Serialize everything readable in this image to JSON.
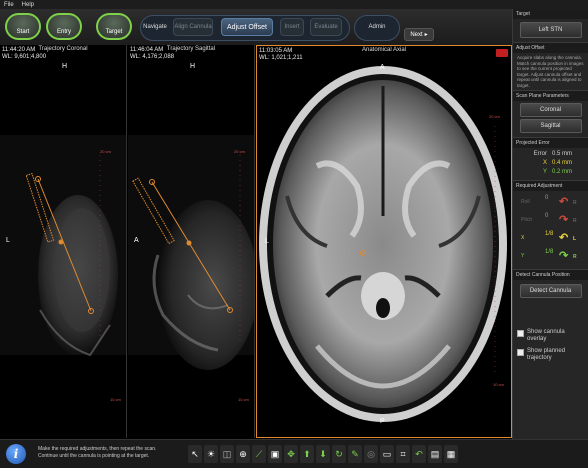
{
  "menu": {
    "file": "File",
    "help": "Help"
  },
  "workflow": {
    "start": "Start",
    "entry": "Entry",
    "target": "Target"
  },
  "nav_group": {
    "navigate": "Navigate",
    "align_cannula": "Align Cannula",
    "adjust_offset": "Adjust Offset",
    "insert": "Insert",
    "evaluate": "Evaluate"
  },
  "admin": "Admin",
  "next": {
    "label": "Next",
    "arrow": "▸"
  },
  "viewports": [
    {
      "title": "Trajectory Coronal",
      "time": "11:44:20 AM",
      "wl": "WL: 9,601;4,800",
      "marker": "H",
      "side": "L",
      "scale_top": "20 cm",
      "scale_bottom": "10 cm"
    },
    {
      "title": "Trajectory Sagittal",
      "time": "11:46:04 AM",
      "wl": "WL: 4,176;2,088",
      "marker": "H",
      "side": "A",
      "scale_top": "20 cm",
      "scale_bottom": "10 cm"
    },
    {
      "title": "Anatomical Axial",
      "time": "11:03:05 AM",
      "wl": "WL: 1,021;1,211",
      "marker": "A",
      "side": "L",
      "scale_top": "20 cm",
      "scale_bottom": "10 cm",
      "bottom_marker": "P"
    }
  ],
  "panel": {
    "target_header": "Target",
    "target_value": "Left STN",
    "adjust_offset_header": "Adjust Offset",
    "adjust_offset_desc": "Acquire slabs along the cannula. Match cannula position in images to see the current projected target. Adjust cannula offset and repeat until cannula is aligned to target.",
    "scan_plane_header": "Scan Plane Parameters",
    "coronal": "Coronal",
    "sagittal": "Sagittal",
    "projected_error_header": "Projected Error",
    "errors": [
      {
        "label": "Error",
        "value": "0.5 mm",
        "color": "#cfcfcf"
      },
      {
        "label": "X",
        "value": "0.4 mm",
        "color": "#e8d23a"
      },
      {
        "label": "Y",
        "value": "0.2 mm",
        "color": "#7ad04a"
      }
    ],
    "required_adjustment_header": "Required Adjustment",
    "adjustments": [
      {
        "label": "Roll",
        "value": "0",
        "arrow": "↶",
        "color": "#d04a3a",
        "letter": "R"
      },
      {
        "label": "Pitch",
        "value": "0",
        "arrow": "↷",
        "color": "#d04a3a",
        "letter": "R"
      },
      {
        "label": "X",
        "value": "1/8",
        "arrow": "↶",
        "color": "#e8d23a",
        "letter": "L"
      },
      {
        "label": "Y",
        "value": "1/8",
        "arrow": "↷",
        "color": "#7ad04a",
        "letter": "R"
      }
    ],
    "detect_header": "Detect Cannula Position",
    "detect_button": "Detect Cannula",
    "show_cannula_overlay": "Show cannula overlay",
    "show_planned_trajectory": "Show planned trajectory"
  },
  "status": {
    "line1": "Make the required adjustments, then repeat the scan.",
    "line2": "Continue until the cannula is pointing at the target."
  },
  "tools": [
    {
      "name": "pointer-tool-icon",
      "glyph": "↖",
      "color": "#ffffff"
    },
    {
      "name": "brightness-tool-icon",
      "glyph": "☀",
      "color": "#ffffff"
    },
    {
      "name": "window-level-tool-icon",
      "glyph": "◫",
      "color": "#bbbbbb"
    },
    {
      "name": "zoom-tool-icon",
      "glyph": "⊕",
      "color": "#ffffff"
    },
    {
      "name": "measure-tool-icon",
      "glyph": "⟋",
      "color": "#7ad04a"
    },
    {
      "name": "fit-screen-tool-icon",
      "glyph": "▣",
      "color": "#ffffff"
    },
    {
      "name": "pan-tool-icon",
      "glyph": "✥",
      "color": "#7ad04a"
    },
    {
      "name": "move-up-tool-icon",
      "glyph": "⬆",
      "color": "#7ad04a"
    },
    {
      "name": "move-down-tool-icon",
      "glyph": "⬇",
      "color": "#7ad04a"
    },
    {
      "name": "rotate-tool-icon",
      "glyph": "↻",
      "color": "#7ad04a"
    },
    {
      "name": "pencil-tool-icon",
      "glyph": "✎",
      "color": "#7ad04a"
    },
    {
      "name": "shape-tool-icon",
      "glyph": "◎",
      "color": "#888888"
    },
    {
      "name": "monitor-tool-icon",
      "glyph": "▭",
      "color": "#ffffff"
    },
    {
      "name": "crop-tool-icon",
      "glyph": "⌗",
      "color": "#ffffff"
    },
    {
      "name": "undo-tool-icon",
      "glyph": "↶",
      "color": "#7ad04a"
    },
    {
      "name": "image-tool-icon",
      "glyph": "▤",
      "color": "#ffffff"
    },
    {
      "name": "layout-tool-icon",
      "glyph": "▦",
      "color": "#ffffff"
    }
  ]
}
